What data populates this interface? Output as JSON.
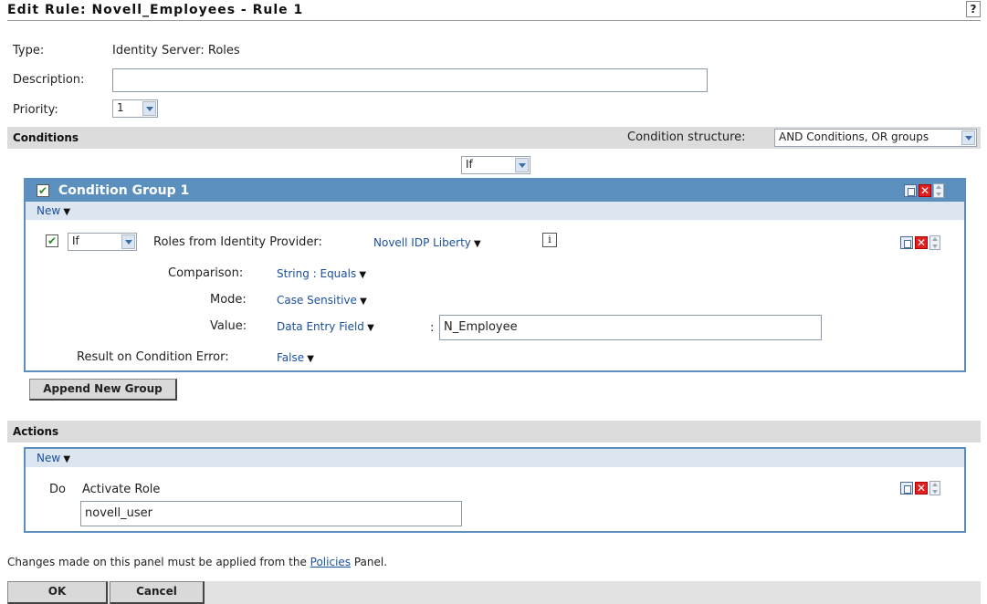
{
  "header": {
    "title": "Edit Rule: Novell_Employees - Rule 1",
    "help_label": "?"
  },
  "form": {
    "type_label": "Type:",
    "type_value": "Identity Server: Roles",
    "description_label": "Description:",
    "description_value": "",
    "priority_label": "Priority:",
    "priority_value": "1"
  },
  "conditions": {
    "section_label": "Conditions",
    "structure_label": "Condition structure:",
    "structure_value": "AND Conditions, OR groups",
    "group_operator": "If",
    "group": {
      "title": "Condition Group 1",
      "new_label": "New",
      "operator": "If",
      "roles_label": "Roles from Identity Provider:",
      "roles_value": "Novell IDP Liberty",
      "info_label": "i",
      "comparison_label": "Comparison:",
      "comparison_value": "String : Equals",
      "mode_label": "Mode:",
      "mode_value": "Case Sensitive",
      "value_label": "Value:",
      "value_type": "Data Entry Field",
      "value_sep": ":",
      "value_input": "N_Employee",
      "error_label": "Result on Condition Error:",
      "error_value": "False"
    },
    "append_button": "Append New Group"
  },
  "actions": {
    "section_label": "Actions",
    "new_label": "New",
    "do_label": "Do",
    "action_name": "Activate Role",
    "role_input": "novell_user"
  },
  "footer": {
    "note_before": "Changes made on this panel must be applied from the ",
    "note_link": "Policies",
    "note_after": " Panel.",
    "ok_label": "OK",
    "cancel_label": "Cancel"
  },
  "icons": {
    "copy": "copy-icon",
    "delete": "delete-icon",
    "move": "move-updown-icon",
    "checkbox": "checkmark",
    "dropdown": "chevron-down-icon"
  },
  "colors": {
    "group_header": "#5a8fbe",
    "section_bar": "#dcdcdc",
    "link": "#1a4f9c",
    "delete": "#e02020"
  }
}
